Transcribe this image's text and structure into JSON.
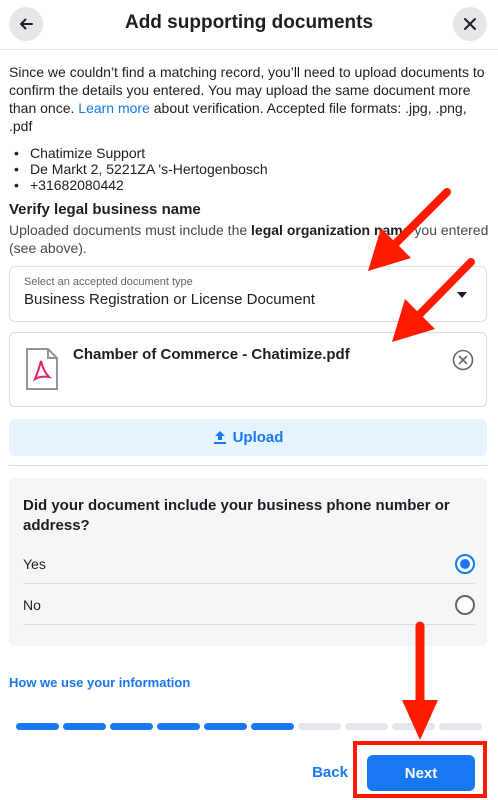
{
  "header": {
    "title": "Add supporting documents",
    "back_icon": "arrow-left-icon",
    "close_icon": "close-icon"
  },
  "intro": {
    "text_before_link": "Since we couldn’t find a matching record, you’ll need to upload documents to confirm the details you entered. You may upload the same document more than once. ",
    "link_text": "Learn more",
    "text_after_link": " about verification. Accepted file formats: .jpg, .png, .pdf"
  },
  "address": {
    "lines": [
      "Chatimize Support",
      "De Markt 2, 5221ZA 's-Hertogenbosch",
      "+31682080442"
    ]
  },
  "verify": {
    "title": "Verify legal business name",
    "desc_before": "Uploaded documents must include the ",
    "desc_bold": "legal organization name",
    "desc_after": " you entered (see above)."
  },
  "document_select": {
    "label": "Select an accepted document type",
    "value": "Business Registration or License Document",
    "caret_icon": "caret-down-icon"
  },
  "file": {
    "name": "Chamber of Commerce - Chatimize.pdf",
    "icon": "pdf-file-icon",
    "remove_icon": "remove-circle-icon"
  },
  "upload": {
    "label": "Upload",
    "icon": "upload-arrow-icon"
  },
  "question": {
    "text": "Did your document include your business phone number or address?",
    "options": [
      {
        "label": "Yes",
        "selected": true
      },
      {
        "label": "No",
        "selected": false
      }
    ]
  },
  "footer": {
    "how_link": "How we use your information",
    "back_label": "Back",
    "next_label": "Next"
  },
  "progress": {
    "total_steps": 10,
    "completed_steps": 6
  },
  "colors": {
    "accent": "#1877f2",
    "annotation": "#ff1a00"
  }
}
